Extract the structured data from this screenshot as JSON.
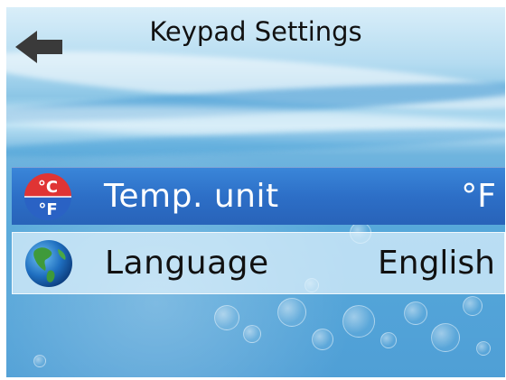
{
  "header": {
    "title": "Keypad Settings",
    "back_icon": "back-arrow-icon"
  },
  "settings": [
    {
      "label": "Temp. unit",
      "value": "°F",
      "icon": "temperature-unit-icon",
      "icon_text_c": "°C",
      "icon_text_f": "°F",
      "selected": true
    },
    {
      "label": "Language",
      "value": "English",
      "icon": "globe-icon",
      "selected": false
    }
  ],
  "colors": {
    "selected_row": "#2d6fc7",
    "unselected_row": "#e1f2fc",
    "title_text": "#111111"
  }
}
